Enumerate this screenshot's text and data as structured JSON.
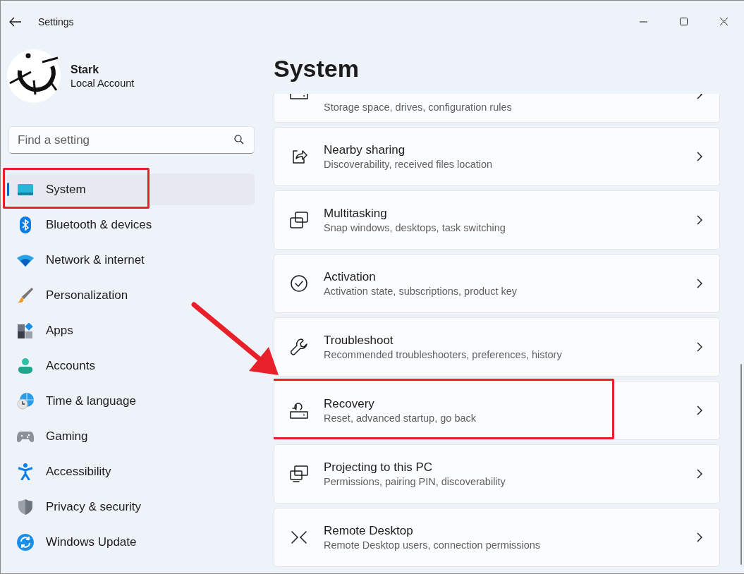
{
  "window": {
    "title": "Settings"
  },
  "account": {
    "name": "Stark",
    "type": "Local Account"
  },
  "search": {
    "placeholder": "Find a setting"
  },
  "sidebar": {
    "items": [
      {
        "label": "System",
        "selected": true,
        "highlighted": true
      },
      {
        "label": "Bluetooth & devices",
        "selected": false,
        "highlighted": false
      },
      {
        "label": "Network & internet",
        "selected": false,
        "highlighted": false
      },
      {
        "label": "Personalization",
        "selected": false,
        "highlighted": false
      },
      {
        "label": "Apps",
        "selected": false,
        "highlighted": false
      },
      {
        "label": "Accounts",
        "selected": false,
        "highlighted": false
      },
      {
        "label": "Time & language",
        "selected": false,
        "highlighted": false
      },
      {
        "label": "Gaming",
        "selected": false,
        "highlighted": false
      },
      {
        "label": "Accessibility",
        "selected": false,
        "highlighted": false
      },
      {
        "label": "Privacy & security",
        "selected": false,
        "highlighted": false
      },
      {
        "label": "Windows Update",
        "selected": false,
        "highlighted": false
      }
    ]
  },
  "page": {
    "title": "System",
    "cards": [
      {
        "description": "Storage space, drives, configuration rules",
        "highlighted": false
      },
      {
        "title": "Nearby sharing",
        "description": "Discoverability, received files location",
        "highlighted": false
      },
      {
        "title": "Multitasking",
        "description": "Snap windows, desktops, task switching",
        "highlighted": false
      },
      {
        "title": "Activation",
        "description": "Activation state, subscriptions, product key",
        "highlighted": false
      },
      {
        "title": "Troubleshoot",
        "description": "Recommended troubleshooters, preferences, history",
        "highlighted": false
      },
      {
        "title": "Recovery",
        "description": "Reset, advanced startup, go back",
        "highlighted": true
      },
      {
        "title": "Projecting to this PC",
        "description": "Permissions, pairing PIN, discoverability",
        "highlighted": false
      },
      {
        "title": "Remote Desktop",
        "description": "Remote Desktop users, connection permissions",
        "highlighted": false
      }
    ]
  }
}
